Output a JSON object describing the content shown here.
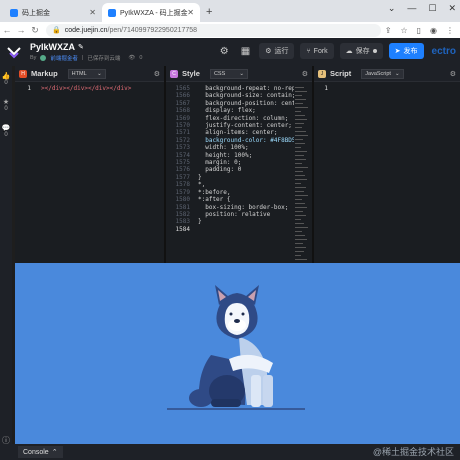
{
  "browser": {
    "tabs": [
      {
        "label": "码上掘金",
        "active": false
      },
      {
        "label": "PyIkWXZA - 码上掘金",
        "active": true
      }
    ],
    "new_tab": "+",
    "url_host": "code.juejin.cn",
    "url_path": "/pen/7140997922950217758"
  },
  "app": {
    "title": "PyIkWXZA",
    "author_prefix": "By",
    "author": "前端掘金者",
    "save_status": "已保存到云端",
    "views": "0",
    "run_label": "运行",
    "fork_label": "Fork",
    "save_label": "保存",
    "publish_label": "发布",
    "brand_partial": "ectro"
  },
  "rail": {
    "like_count": "0",
    "star_count": "0",
    "comment_count": "0"
  },
  "panes": {
    "markup": {
      "name": "Markup",
      "lang": "HTML",
      "line": "1",
      "code": "></div></div></div></div>"
    },
    "style": {
      "name": "Style",
      "lang": "CSS",
      "lines": [
        "1565",
        "1566",
        "1567",
        "1568",
        "1569",
        "1570",
        "1571",
        "1572",
        "1573",
        "1574",
        "1575",
        "1576",
        "1577",
        "1578",
        "1579",
        "1580",
        "1581",
        "1582",
        "1583",
        "1584"
      ],
      "code": [
        "  background-repeat: no-repeat;",
        "  background-size: contain;",
        "  background-position: center;",
        "  display: flex;",
        "  flex-direction: column;",
        "  justify-content: center;",
        "  align-items: center;",
        "  background-color: #4F8BD5;",
        "  width: 100%;",
        "  height: 100%;",
        "  margin: 0;",
        "  padding: 0",
        "}",
        "*,",
        "*:before,",
        "*:after {",
        "  box-sizing: border-box;",
        "  position: relative",
        "}",
        ""
      ]
    },
    "script": {
      "name": "Script",
      "lang": "JavaScript",
      "line": "1"
    }
  },
  "preview": {
    "background": "#4a89dc"
  },
  "console": {
    "label": "Console"
  },
  "watermark": "@稀土掘金技术社区",
  "colors": {
    "accent": "#1e80ff",
    "editor_bg": "#1a1d21",
    "preview_bg": "#4a89dc"
  }
}
